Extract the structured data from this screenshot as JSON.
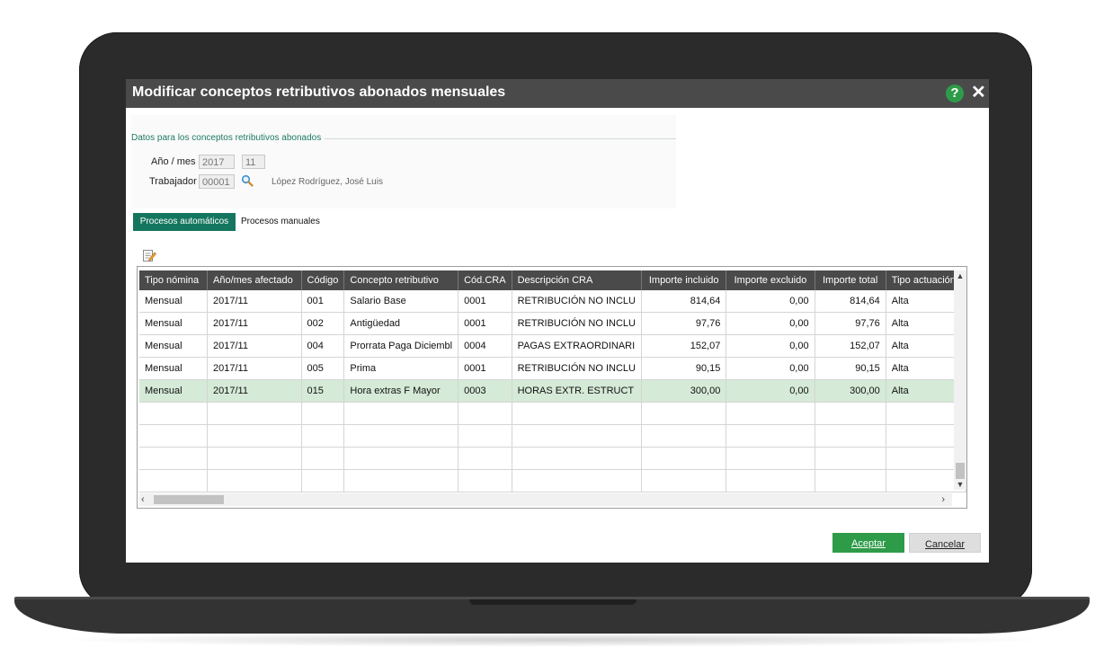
{
  "window": {
    "title": "Modificar conceptos retributivos abonados mensuales",
    "help_icon": "?",
    "close_icon": "✕"
  },
  "form": {
    "legend": "Datos para los conceptos retributivos abonados",
    "year_month_label": "Año / mes",
    "year_value": "2017",
    "month_value": "11",
    "worker_label": "Trabajador",
    "worker_code": "00001",
    "worker_name": "López Rodríguez, José Luis"
  },
  "tabs": [
    {
      "label": "Procesos automáticos",
      "active": true
    },
    {
      "label": "Procesos manuales",
      "active": false
    }
  ],
  "table": {
    "columns": [
      "Tipo nómina",
      "Año/mes afectado",
      "Código",
      "Concepto retributivo",
      "Cód.CRA",
      "Descripción CRA",
      "Importe incluido",
      "Importe excluido",
      "Importe total",
      "Tipo actuación"
    ],
    "rows": [
      [
        "Mensual",
        "2017/11",
        "001",
        "Salario Base",
        "0001",
        "RETRIBUCIÓN NO INCLU",
        "814,64",
        "0,00",
        "814,64",
        "Alta"
      ],
      [
        "Mensual",
        "2017/11",
        "002",
        "Antigüedad",
        "0001",
        "RETRIBUCIÓN NO INCLU",
        "97,76",
        "0,00",
        "97,76",
        "Alta"
      ],
      [
        "Mensual",
        "2017/11",
        "004",
        "Prorrata Paga Diciembl",
        "0004",
        "PAGAS EXTRAORDINARI",
        "152,07",
        "0,00",
        "152,07",
        "Alta"
      ],
      [
        "Mensual",
        "2017/11",
        "005",
        "Prima",
        "0001",
        "RETRIBUCIÓN NO INCLU",
        "90,15",
        "0,00",
        "90,15",
        "Alta"
      ],
      [
        "Mensual",
        "2017/11",
        "015",
        "Hora extras F Mayor",
        "0003",
        "HORAS EXTR. ESTRUCT",
        "300,00",
        "0,00",
        "300,00",
        "Alta"
      ]
    ],
    "selected_row": 4,
    "empty_rows": 4
  },
  "buttons": {
    "ok": "Aceptar",
    "cancel": "Cancelar"
  },
  "colors": {
    "accent": "#15765f",
    "ok_button": "#2e9b49",
    "title_bar": "#4a4a4a",
    "selected_row": "#d5ead7"
  }
}
